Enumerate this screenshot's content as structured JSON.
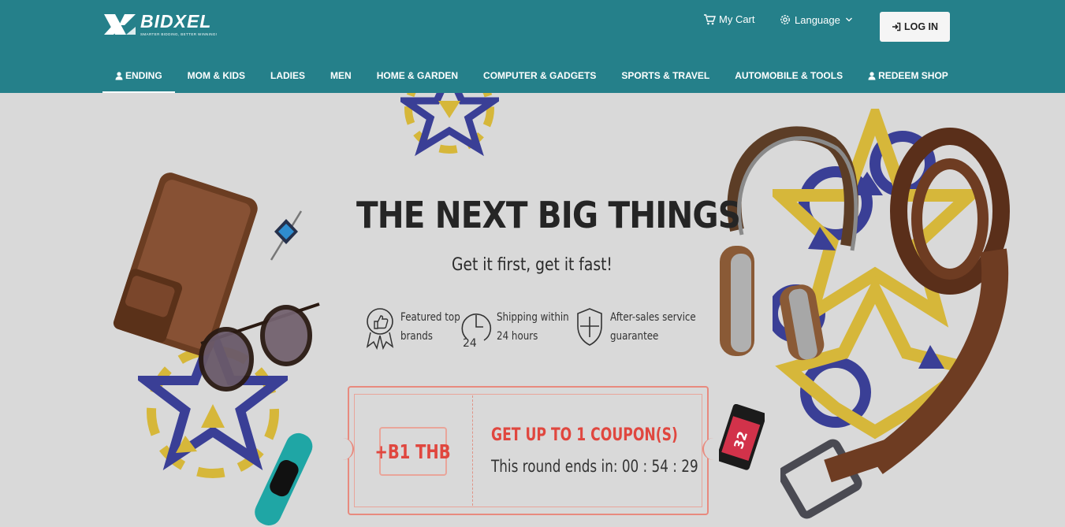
{
  "brand": {
    "name": "BIDXEL",
    "tagline": "SMARTER BIDDING, BETTER WINNING!"
  },
  "header": {
    "cart_label": "My Cart",
    "language_label": "Language",
    "login_label": "LOG IN"
  },
  "nav": {
    "items": [
      {
        "label": "ENDING",
        "icon": "user-icon",
        "active": true
      },
      {
        "label": "MOM & KIDS"
      },
      {
        "label": "LADIES"
      },
      {
        "label": "MEN"
      },
      {
        "label": "HOME & GARDEN"
      },
      {
        "label": "COMPUTER & GADGETS"
      },
      {
        "label": "SPORTS & TRAVEL"
      },
      {
        "label": "AUTOMOBILE & TOOLS"
      },
      {
        "label": "REDEEM SHOP",
        "icon": "user-icon"
      }
    ]
  },
  "banner": {
    "title": "THE NEXT BIG THINGS",
    "subtitle": "Get it first, get it fast!",
    "features": [
      {
        "icon": "thumbs-up-badge-icon",
        "text": "Featured top\nbrands"
      },
      {
        "icon": "clock-24-icon",
        "text": "Shipping within\n24 hours"
      },
      {
        "icon": "shield-plus-icon",
        "text": "After-sales service\nguarantee"
      }
    ],
    "coupon": {
      "amount": "+B1 THB",
      "title": "GET UP TO 1 COUPON(S)",
      "timer_text": "This round ends in: 00 : 54 : 29"
    },
    "memory_card_label": "32"
  },
  "colors": {
    "header_bg": "#25808a",
    "banner_bg": "#d9d9d9",
    "accent_red": "#e0473f"
  }
}
